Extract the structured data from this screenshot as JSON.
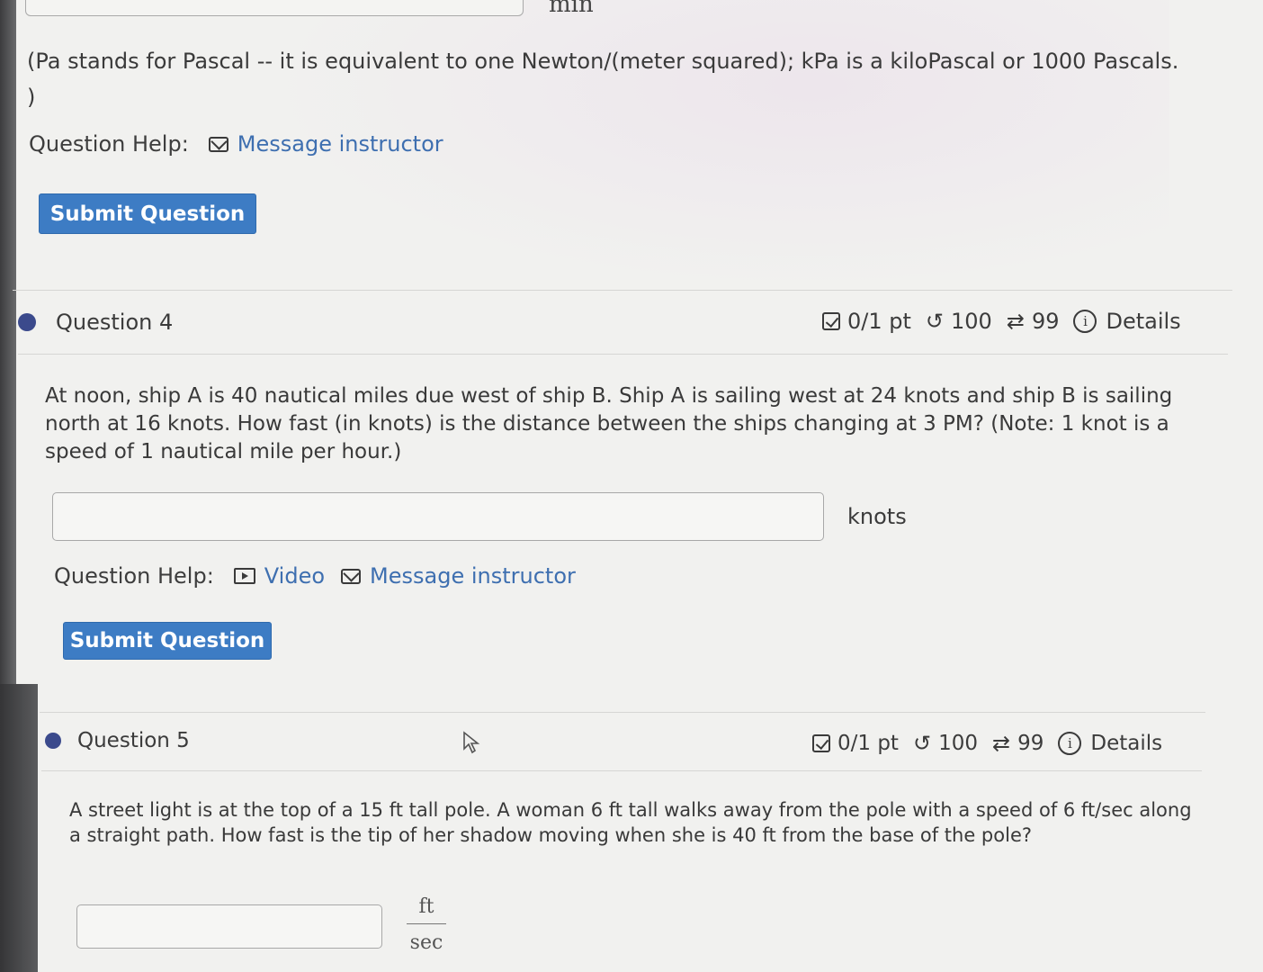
{
  "previous_question": {
    "answer_value": "",
    "unit": "min",
    "note": "(Pa stands for Pascal -- it is equivalent to one Newton/(meter squared); kPa is a kiloPascal or 1000 Pascals.",
    "note_close": ")",
    "help_label": "Question Help:",
    "message_link": "Message instructor",
    "submit_label": "Submit Question"
  },
  "questions": [
    {
      "title": "Question 4",
      "score": "0/1 pt",
      "retries": "100",
      "submissions": "99",
      "details_label": "Details",
      "text": "At noon, ship A is 40 nautical miles due west of ship B. Ship A is sailing west at 24 knots and ship B is sailing north at 16 knots. How fast (in knots) is the distance between the ships changing at 3 PM? (Note: 1 knot is a speed of 1 nautical mile per hour.)",
      "answer_value": "",
      "unit": "knots",
      "help_label": "Question Help:",
      "video_link": "Video",
      "message_link": "Message instructor",
      "submit_label": "Submit Question"
    },
    {
      "title": "Question 5",
      "score": "0/1 pt",
      "retries": "100",
      "submissions": "99",
      "details_label": "Details",
      "text": "A street light is at the top of a 15 ft tall pole. A woman 6 ft tall walks away from the pole with a speed of 6 ft/sec along a straight path. How fast is the tip of her shadow moving when she is 40 ft from the base of the pole?",
      "answer_value": "",
      "unit_numerator": "ft",
      "unit_denominator": "sec"
    }
  ],
  "colors": {
    "accent": "#3d7cc4",
    "link": "#3e6fb0",
    "bullet": "#3b4a8c"
  }
}
